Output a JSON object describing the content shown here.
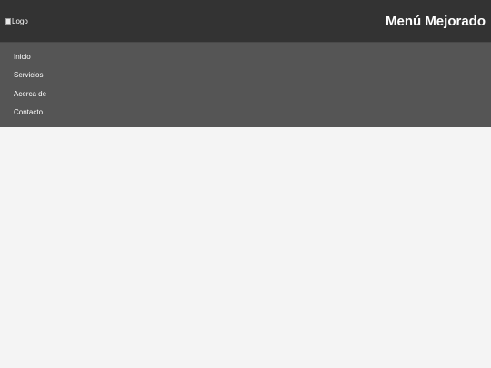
{
  "header": {
    "logo_alt": "Logo",
    "title": "Menú Mejorado"
  },
  "menu": {
    "items": [
      {
        "label": "Inicio"
      },
      {
        "label": "Servicios"
      },
      {
        "label": "Acerca de"
      },
      {
        "label": "Contacto"
      }
    ]
  },
  "colors": {
    "header_bg": "#333333",
    "menu_bg": "#555555",
    "page_bg": "#f4f4f4",
    "text": "#ffffff"
  }
}
